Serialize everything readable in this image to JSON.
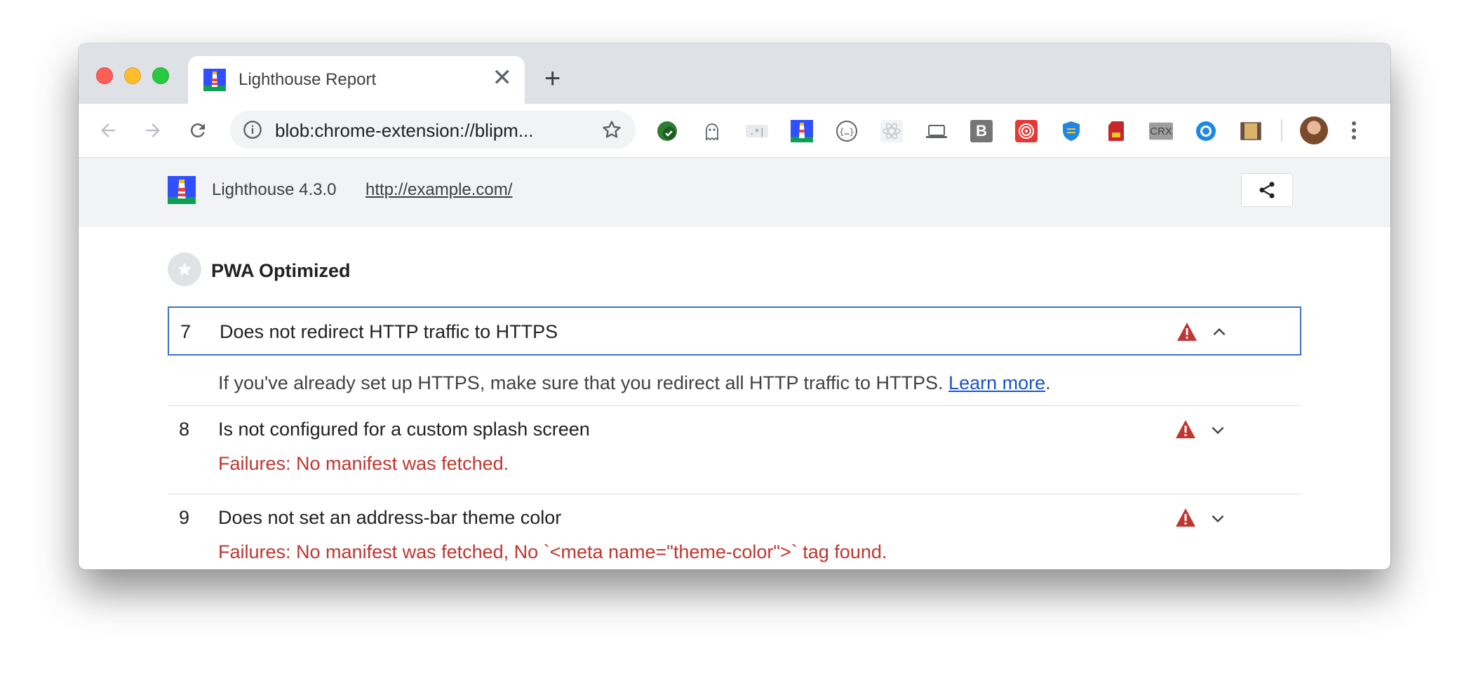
{
  "browser": {
    "tab_title": "Lighthouse Report",
    "tab_close": "✕",
    "new_tab": "+",
    "url": "blob:chrome-extension://blipm...",
    "extensions": [
      "shield-check-icon",
      "ghost-icon",
      "regex-icon",
      "lighthouse-icon",
      "json-icon",
      "react-icon",
      "laptop-icon",
      "b-icon",
      "target-icon",
      "shield-blue-icon",
      "sd-card-icon",
      "crx-icon",
      "globe-icon",
      "film-icon"
    ],
    "crx_label": "CRX",
    "b_label": "B"
  },
  "report": {
    "version": "Lighthouse 4.3.0",
    "url": "http://example.com/",
    "group_title": "PWA Optimized",
    "audits": [
      {
        "number": "7",
        "title": "Does not redirect HTTP traffic to HTTPS",
        "description": "If you've already set up HTTPS, make sure that you redirect all HTTP traffic to HTTPS. ",
        "link": "Learn more",
        "period": ".",
        "expanded": true
      },
      {
        "number": "8",
        "title": "Is not configured for a custom splash screen",
        "failure": "Failures: No manifest was fetched."
      },
      {
        "number": "9",
        "title": "Does not set an address-bar theme color",
        "failure": "Failures: No manifest was fetched, No `<meta name=\"theme-color\">` tag found."
      }
    ]
  },
  "colors": {
    "accent": "#3b6fd6",
    "fail": "#c0352f",
    "link": "#1a54c7"
  }
}
